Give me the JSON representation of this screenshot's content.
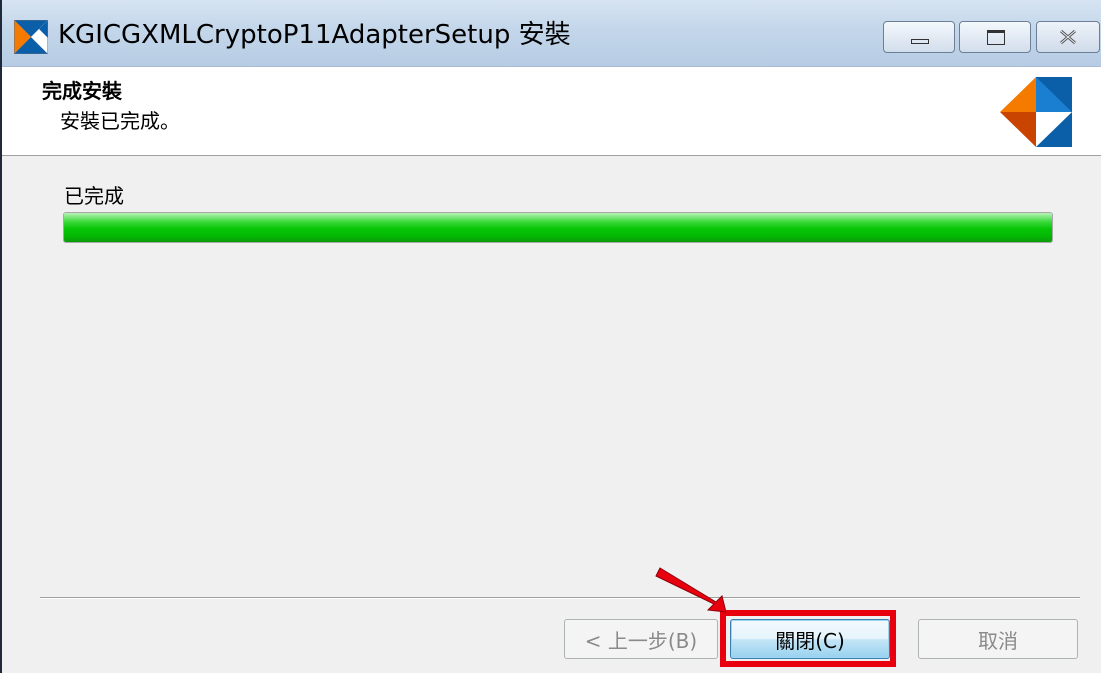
{
  "window": {
    "title": "KGICGXMLCryptoP11AdapterSetup 安裝",
    "icon": "setup-logo-icon"
  },
  "header": {
    "title": "完成安裝",
    "subtitle": "安裝已完成。"
  },
  "progress": {
    "status": "已完成",
    "value": 1.0,
    "color": "#06c506"
  },
  "buttons": {
    "back": "< 上一步(B)",
    "close": "關閉(C)",
    "cancel": "取消"
  },
  "annotation": {
    "highlight_color": "#e8000f"
  }
}
